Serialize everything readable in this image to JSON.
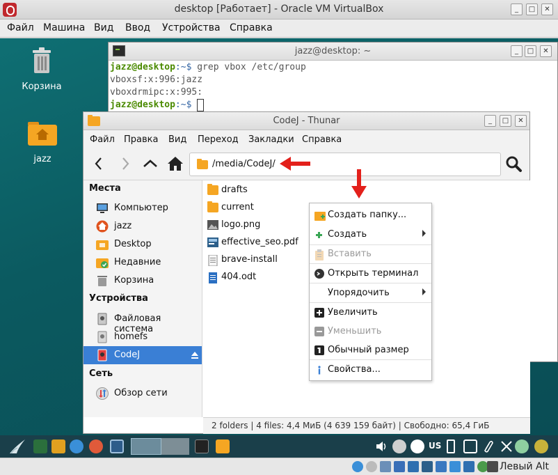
{
  "vbox": {
    "title": "desktop [Работает] - Oracle VM VirtualBox",
    "menu": [
      "Файл",
      "Машина",
      "Вид",
      "Ввод",
      "Устройства",
      "Справка"
    ],
    "host_key": "Левый Alt"
  },
  "desktop_icons": {
    "trash": "Корзина",
    "home": "jazz"
  },
  "terminal": {
    "title": "jazz@desktop: ~",
    "prompt_user": "jazz@desktop",
    "prompt_path": ":~$",
    "command": " grep vbox /etc/group",
    "output_1": "vboxsf:x:996:jazz",
    "output_2": "vboxdrmipc:x:995:"
  },
  "thunar": {
    "title": "CodeJ - Thunar",
    "menu": [
      "Файл",
      "Правка",
      "Вид",
      "Переход",
      "Закладки",
      "Справка"
    ],
    "path": "/media/CodeJ/",
    "sidebar": {
      "places_heading": "Места",
      "places": [
        "Компьютер",
        "jazz",
        "Desktop",
        "Недавние",
        "Корзина"
      ],
      "devices_heading": "Устройства",
      "devices": [
        "Файловая система",
        "homefs",
        "CodeJ"
      ],
      "network_heading": "Сеть",
      "network": [
        "Обзор сети"
      ]
    },
    "files": [
      "drafts",
      "current",
      "logo.png",
      "effective_seo.pdf",
      "brave-install",
      "404.odt"
    ],
    "status": "2 folders  |  4 files: 4,4 МиБ (4 639 159 байт)  |  Свободно: 65,4 ГиБ"
  },
  "context_menu": {
    "create_folder": "Создать папку...",
    "create": "Создать",
    "paste": "Вставить",
    "open_terminal": "Открыть терминал",
    "arrange": "Упорядочить",
    "zoom_in": "Увеличить",
    "zoom_out": "Уменьшить",
    "normal_size": "Обычный размер",
    "properties": "Свойства..."
  },
  "taskbar": {
    "layout": "US"
  },
  "colors": {
    "selection": "#3a7fd5",
    "folder": "#f5a623",
    "annotation": "#e3201b",
    "prompt": "#4a8a00"
  }
}
